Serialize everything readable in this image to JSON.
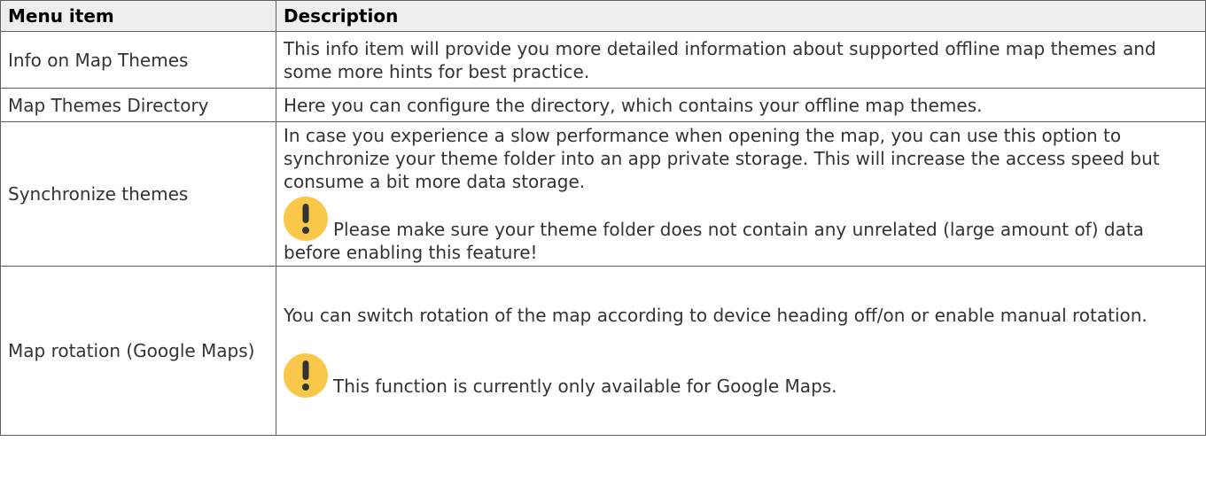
{
  "table": {
    "headers": [
      "Menu item",
      "Description"
    ],
    "rows": [
      {
        "item": "Info on Map Themes",
        "description": "This info item will provide you more detailed information about supported offline map themes and some more hints for best practice."
      },
      {
        "item": "Map Themes Directory",
        "description": "Here you can configure the directory, which contains your offline map themes."
      },
      {
        "item": "Synchronize themes",
        "description": "In case you experience a slow performance when opening the map, you can use this option to synchronize your theme folder into an app private storage. This will increase the access speed but consume a bit more data storage.",
        "note": "Please make sure your theme folder does not contain any unrelated (large amount of) data before enabling this feature!"
      },
      {
        "item": "Map rotation (Google Maps)",
        "description": "You can switch rotation of the map according to device heading off/on or enable manual rotation.",
        "note": "This function is currently only available for Google Maps."
      }
    ]
  },
  "icons": {
    "note_icon": "exclamation-warning-icon"
  },
  "colors": {
    "header_bg": "#eeeeee",
    "border": "#5f5f5f",
    "warning_circle": "#f9c74a",
    "warning_mark": "#333333"
  }
}
